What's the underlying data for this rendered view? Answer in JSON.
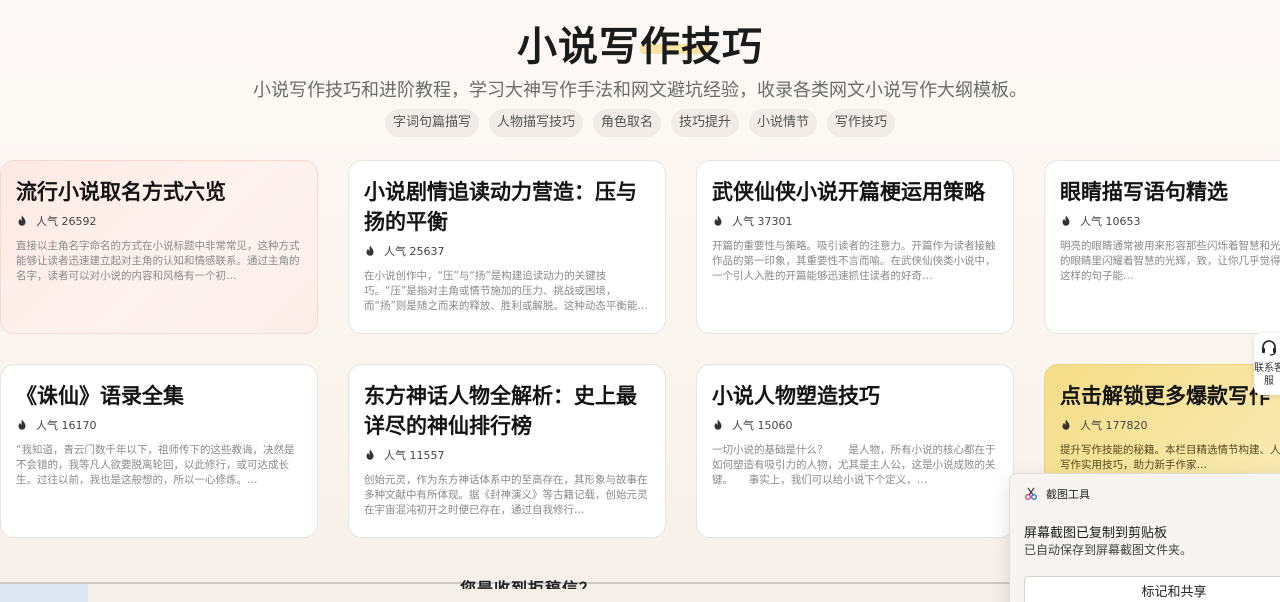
{
  "header": {
    "title": "小说写作技巧",
    "subtitle": "小说写作技巧和进阶教程，学习大神写作手法和网文避坑经验，收录各类网文小说写作大纲模板。",
    "tags": [
      "字词句篇描写",
      "人物描写技巧",
      "角色取名",
      "技巧提升",
      "小说情节",
      "写作技巧"
    ]
  },
  "cards": [
    {
      "title": "流行小说取名方式六览",
      "popularity": "人气 26592",
      "desc": "直接以主角名字命名的方式在小说标题中非常常见，这种方式能够让读者迅速建立起对主角的认知和情感联系。通过主角的名字，读者可以对小说的内容和风格有一个初…"
    },
    {
      "title": "小说剧情追读动力营造：压与扬的平衡",
      "popularity": "人气 25637",
      "desc": "在小说创作中，“压”与“扬”是构建追读动力的关键技巧。“压”是指对主角或情节施加的压力、挑战或困境，而“扬”则是随之而来的释放、胜利或解脱。这种动态平衡能够…"
    },
    {
      "title": "武侠仙侠小说开篇梗运用策略",
      "popularity": "人气 37301",
      "desc": "开篇的重要性与策略。吸引读者的注意力。开篇作为读者接触作品的第一印象，其重要性不言而喻。在武侠仙侠类小说中，一个引人入胜的开篇能够迅速抓住读者的好奇…"
    },
    {
      "title": "眼睛描写语句精选",
      "popularity": "人气 10653",
      "desc": "明亮的眼睛通常被用来形容那些闪烁着智慧和光。例如，“她的眼睛里闪耀着智慧的光辉，致，让你几乎觉得他有妖法。” 这样的句子能…"
    },
    {
      "title": "《诛仙》语录全集",
      "popularity": "人气 16170",
      "desc": "“我知道，青云门数千年以下，祖师传下的这些教诲，决然是不会错的，我等凡人欲要脱离轮回，以此修行，或可达成长生。过往以前，我也是这般想的，所以一心修炼。…"
    },
    {
      "title": "东方神话人物全解析：史上最详尽的神仙排行榜",
      "popularity": "人气 11557",
      "desc": "创始元灵，作为东方神话体系中的至高存在，其形象与故事在多种文献中有所体现。据《封神演义》等古籍记载，创始元灵在宇宙混沌初开之时便已存在，通过自我修行…"
    },
    {
      "title": "小说人物塑造技巧",
      "popularity": "人气 15060",
      "desc": "一切小说的基础是什么？　　是人物，所有小说的核心都在于如何塑造有吸引力的人物，尤其是主人公，这是小说成败的关键。　　事实上，我们可以给小说下个定义，…"
    },
    {
      "title": "点击解锁更多爆款写作",
      "popularity": "人气 177820",
      "desc": "提升写作技能的秘籍。本栏目精选情节构建、人物塑造等爆款写作实用技巧，助力新手作家…"
    }
  ],
  "side_float": {
    "label": "联系客服"
  },
  "bottom_text": "您是收到拒稿信？",
  "toast": {
    "app": "截图工具",
    "message": "屏幕截图已复制到剪贴板",
    "sub": "已自动保存到屏幕截图文件夹。",
    "button": "标记和共享"
  },
  "colors": {
    "accent_highlight": "#f7e3a3",
    "card_pink": "#fde8e3",
    "card_gold": "#f5dd86"
  }
}
